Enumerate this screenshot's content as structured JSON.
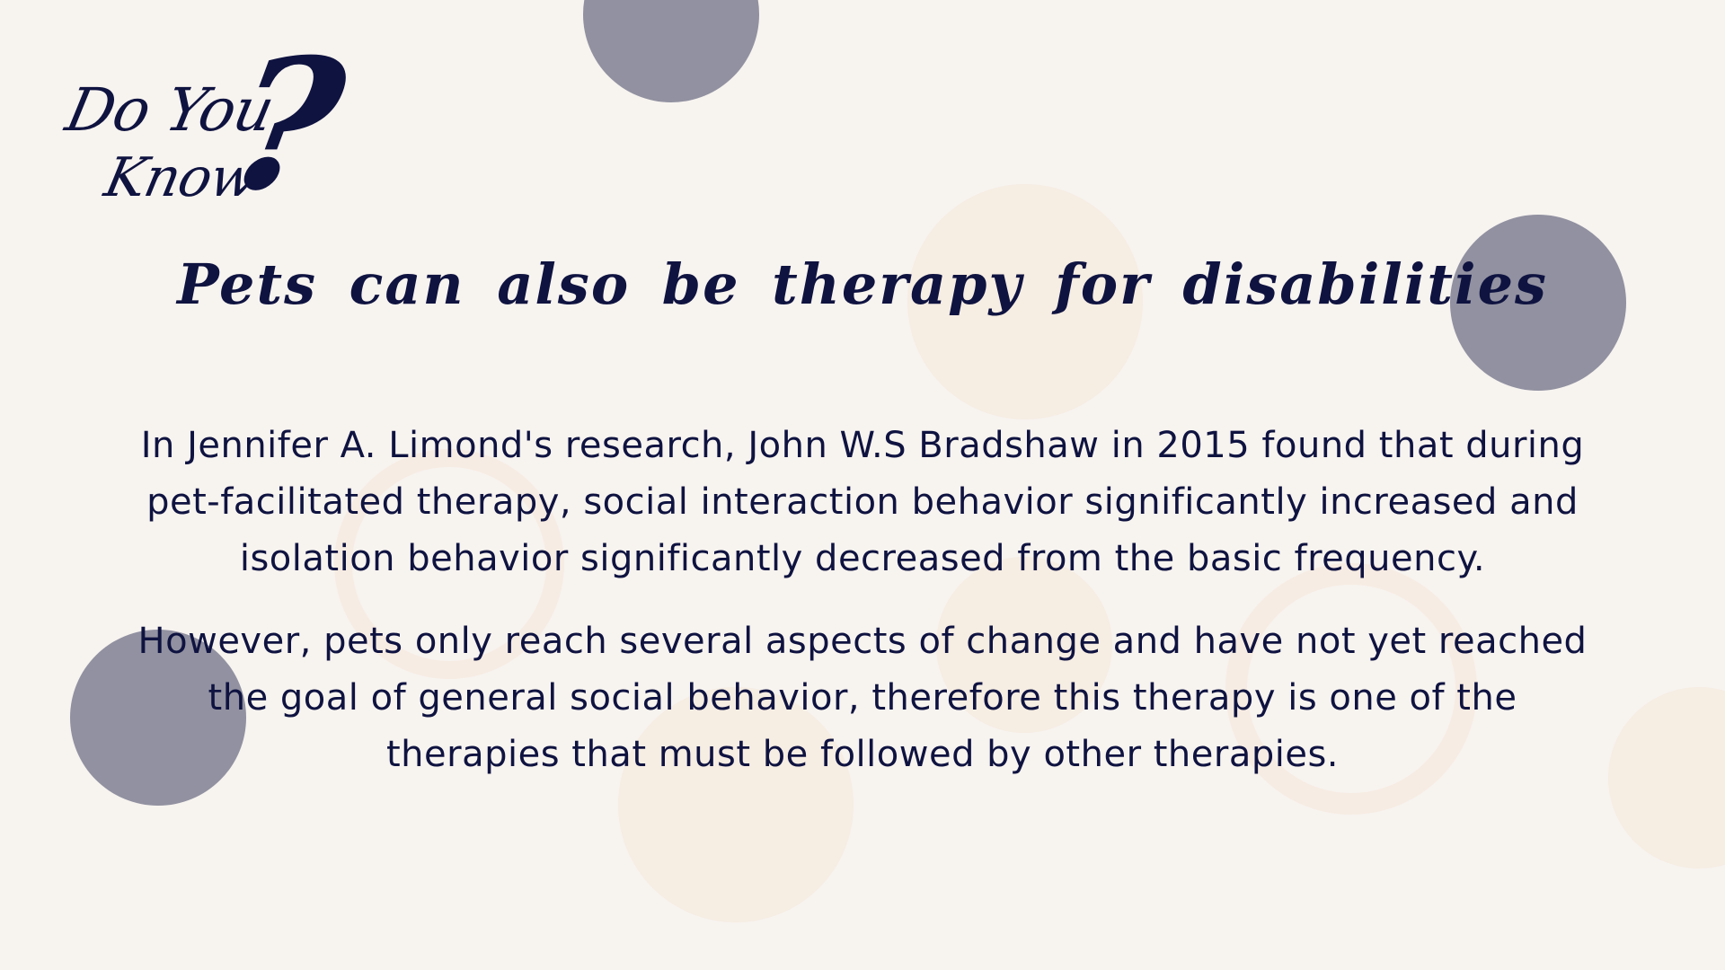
{
  "heading": {
    "line1": "Do You",
    "line2": "Know",
    "mark": "?"
  },
  "title": "Pets can also be therapy for disabilities",
  "paragraphs": [
    "In Jennifer A. Limond's research, John W.S Bradshaw in 2015 found that during pet-facilitated therapy, social interaction behavior significantly increased and isolation behavior significantly decreased from the basic frequency.",
    "However, pets only reach several aspects of change and have not yet reached the goal of general social behavior, therefore this therapy is one of the therapies that must be followed by other therapies."
  ],
  "colors": {
    "background": "#f7f3ef",
    "text": "#0f1340",
    "gray_circle": "#9191a1",
    "peach_circle": "#f6ebe1"
  }
}
